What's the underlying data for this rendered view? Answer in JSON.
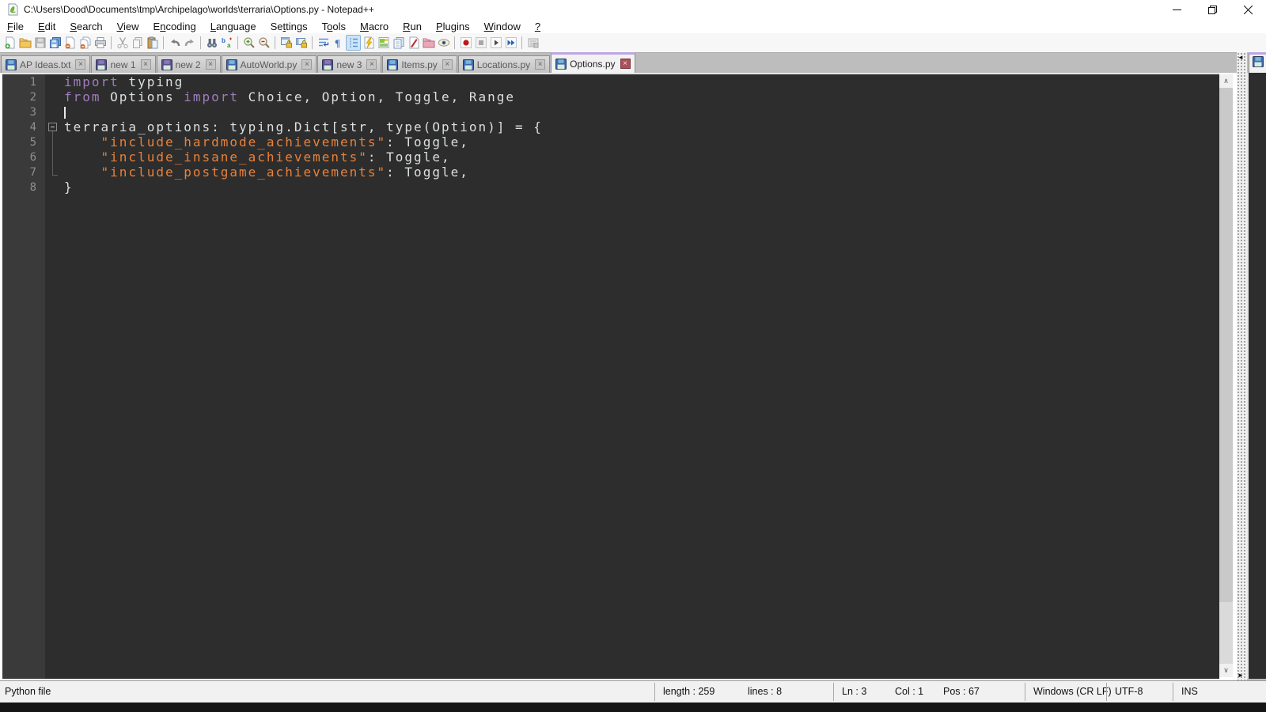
{
  "window": {
    "title": "C:\\Users\\Dood\\Documents\\tmp\\Archipelago\\worlds\\terraria\\Options.py - Notepad++",
    "caption_buttons": [
      "minimize",
      "restore",
      "close"
    ]
  },
  "menu": {
    "items": [
      {
        "pre": "",
        "key": "F",
        "post": "ile"
      },
      {
        "pre": "",
        "key": "E",
        "post": "dit"
      },
      {
        "pre": "",
        "key": "S",
        "post": "earch"
      },
      {
        "pre": "",
        "key": "V",
        "post": "iew"
      },
      {
        "pre": "E",
        "key": "n",
        "post": "coding"
      },
      {
        "pre": "",
        "key": "L",
        "post": "anguage"
      },
      {
        "pre": "Se",
        "key": "t",
        "post": "tings"
      },
      {
        "pre": "T",
        "key": "o",
        "post": "ols"
      },
      {
        "pre": "",
        "key": "M",
        "post": "acro"
      },
      {
        "pre": "",
        "key": "R",
        "post": "un"
      },
      {
        "pre": "",
        "key": "P",
        "post": "lugins"
      },
      {
        "pre": "",
        "key": "W",
        "post": "indow"
      },
      {
        "pre": "",
        "key": "?",
        "post": ""
      }
    ]
  },
  "toolbar": {
    "icons": [
      "new-file",
      "open-folder",
      "save",
      "save-all",
      "close",
      "close-all",
      "print",
      "sep",
      "cut",
      "copy",
      "paste",
      "sep",
      "undo",
      "redo",
      "sep",
      "find",
      "replace",
      "sep",
      "zoom-in",
      "zoom-out",
      "sep",
      "sync-vertical",
      "sync-horizontal",
      "sep",
      "word-wrap",
      "show-all-characters",
      "show-indent-guide",
      "user-defined-language",
      "document-map",
      "document-list",
      "function-list",
      "folder-as-workspace",
      "monitoring",
      "sep",
      "macro-record",
      "macro-stop",
      "macro-play",
      "macro-run-multiple",
      "sep",
      "macro-save"
    ],
    "active_icon": "show-indent-guide"
  },
  "tabs": [
    {
      "label": "AP Ideas.txt",
      "icon_color": "blue",
      "active": false
    },
    {
      "label": "new 1",
      "icon_color": "violet",
      "active": false
    },
    {
      "label": "new 2",
      "icon_color": "violet",
      "active": false
    },
    {
      "label": "AutoWorld.py",
      "icon_color": "blue",
      "active": false
    },
    {
      "label": "new 3",
      "icon_color": "violet",
      "active": false
    },
    {
      "label": "Items.py",
      "icon_color": "blue",
      "active": false
    },
    {
      "label": "Locations.py",
      "icon_color": "blue",
      "active": false
    },
    {
      "label": "Options.py",
      "icon_color": "blue",
      "active": true
    }
  ],
  "tab_close_glyph": "×",
  "editor": {
    "caret_line": 3,
    "colors": {
      "background": "#2d2d2d",
      "gutter": "#3a3a3a",
      "keyword": "#a07cbc",
      "string": "#e8813a",
      "default_text": "#dcdfe0",
      "line_number": "#8f8f8f"
    },
    "lines": [
      {
        "num": "1",
        "fold": "",
        "segments": [
          {
            "c": "kw",
            "t": "import"
          },
          {
            "c": "def",
            "t": " typing"
          }
        ]
      },
      {
        "num": "2",
        "fold": "",
        "segments": [
          {
            "c": "kw",
            "t": "from"
          },
          {
            "c": "def",
            "t": " Options "
          },
          {
            "c": "kw",
            "t": "import"
          },
          {
            "c": "def",
            "t": " Choice, Option, Toggle, Range"
          }
        ]
      },
      {
        "num": "3",
        "fold": "",
        "segments": []
      },
      {
        "num": "4",
        "fold": "start",
        "segments": [
          {
            "c": "def",
            "t": "terraria_options: typing.Dict[str, type(Option)] = {"
          }
        ]
      },
      {
        "num": "5",
        "fold": "mid",
        "segments": [
          {
            "c": "def",
            "t": "    "
          },
          {
            "c": "str",
            "t": "\"include_hardmode_achievements\""
          },
          {
            "c": "def",
            "t": ": Toggle,"
          }
        ]
      },
      {
        "num": "6",
        "fold": "mid",
        "segments": [
          {
            "c": "def",
            "t": "    "
          },
          {
            "c": "str",
            "t": "\"include_insane_achievements\""
          },
          {
            "c": "def",
            "t": ": Toggle,"
          }
        ]
      },
      {
        "num": "7",
        "fold": "end",
        "segments": [
          {
            "c": "def",
            "t": "    "
          },
          {
            "c": "str",
            "t": "\"include_postgame_achievements\""
          },
          {
            "c": "def",
            "t": ": Toggle,"
          }
        ]
      },
      {
        "num": "8",
        "fold": "",
        "segments": [
          {
            "c": "def",
            "t": "}"
          }
        ]
      }
    ]
  },
  "scroll": {
    "up_glyph": "∧",
    "down_glyph": "∨",
    "split_left_glyph": "◄",
    "split_right_glyph": "►"
  },
  "statusbar": {
    "doc_type": "Python file",
    "length": "length : 259",
    "lines": "lines : 8",
    "line": "Ln : 3",
    "col": "Col : 1",
    "pos": "Pos : 67",
    "eol": "Windows (CR LF)",
    "encoding": "UTF-8",
    "mode": "INS"
  }
}
